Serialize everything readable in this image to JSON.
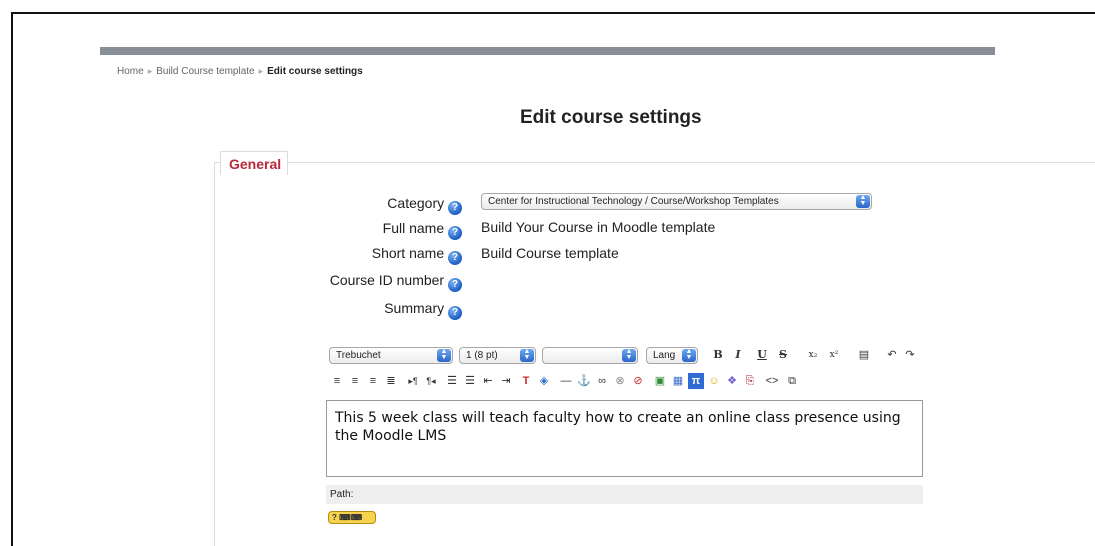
{
  "breadcrumb": {
    "home": "Home",
    "course": "Build Course template",
    "current": "Edit course settings"
  },
  "page_title": "Edit course settings",
  "section_legend": "General",
  "form": {
    "category_label": "Category",
    "category_value": "Center for Instructional Technology / Course/Workshop Templates",
    "fullname_label": "Full name",
    "fullname_value": "Build Your Course in Moodle template",
    "shortname_label": "Short name",
    "shortname_value": "Build Course template",
    "idnumber_label": "Course ID number",
    "summary_label": "Summary"
  },
  "editor": {
    "font_family": "Trebuchet",
    "font_size": "1 (8 pt)",
    "format": "",
    "lang": "Lang",
    "content": "This 5 week class will teach faculty how to create an online class presence using the Moodle LMS",
    "path_label": "Path:",
    "help_label": "?"
  },
  "icons": {
    "help": "question-circle-icon",
    "bold": "B",
    "italic": "I",
    "underline": "U",
    "strike": "S",
    "subscript": "x₂",
    "superscript": "x²"
  }
}
